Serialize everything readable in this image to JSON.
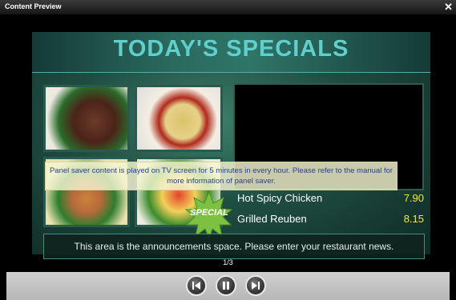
{
  "window": {
    "title": "Content Preview",
    "close_symbol": "✕"
  },
  "board": {
    "heading": "TODAY'S SPECIALS",
    "notice": "Panel saver content is played on TV screen for 5 minutes in every hour. Please refer to the manual for more information of panel saver.",
    "badge": "SPECIAL",
    "menu": [
      {
        "name": "Hot Spicy Chicken",
        "price": "7.90"
      },
      {
        "name": "Grilled Reuben",
        "price": "8.15"
      }
    ],
    "announcement": "This area is the announcements space. Please enter your restaurant news."
  },
  "pager": "1/3",
  "controls": {
    "prev_icon": "skip-previous-icon",
    "pause_icon": "pause-icon",
    "next_icon": "skip-next-icon"
  },
  "colors": {
    "heading": "#5fd0cd",
    "price": "#f5e83a",
    "notice_text": "#2a3f8f",
    "badge": "#7cc142"
  }
}
